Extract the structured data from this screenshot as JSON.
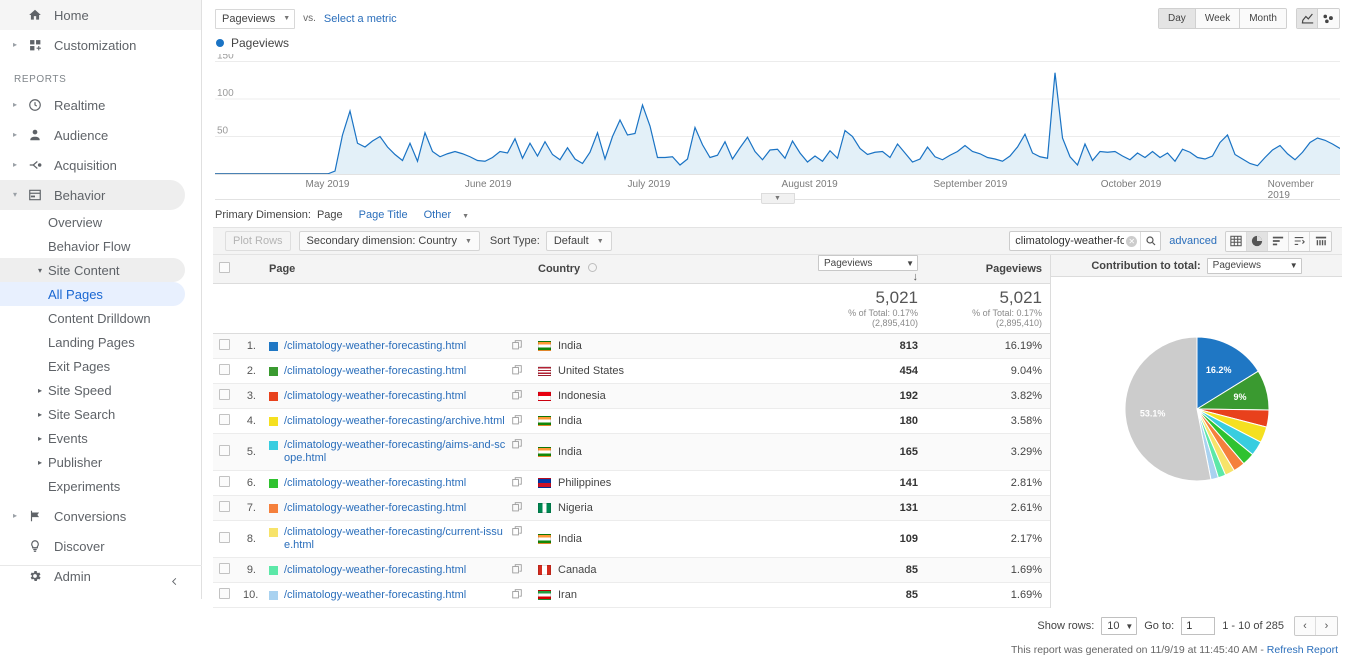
{
  "sidebar": {
    "top_items": [
      {
        "label": "Home",
        "icon": "home-icon",
        "expandable": false
      },
      {
        "label": "Customization",
        "icon": "customization-icon",
        "expandable": true
      }
    ],
    "section_label": "REPORTS",
    "report_items": [
      {
        "label": "Realtime",
        "icon": "realtime-clock-icon",
        "expandable": true
      },
      {
        "label": "Audience",
        "icon": "audience-person-icon",
        "expandable": true
      },
      {
        "label": "Acquisition",
        "icon": "acquisition-icon",
        "expandable": true
      },
      {
        "label": "Behavior",
        "icon": "behavior-icon",
        "expandable": true,
        "selected": true
      }
    ],
    "behavior_children": [
      {
        "label": "Overview"
      },
      {
        "label": "Behavior Flow"
      },
      {
        "label": "Site Content",
        "expanded": true
      },
      {
        "label": "All Pages",
        "active": true
      },
      {
        "label": "Content Drilldown"
      },
      {
        "label": "Landing Pages"
      },
      {
        "label": "Exit Pages"
      },
      {
        "label": "Site Speed",
        "collapsed": true
      },
      {
        "label": "Site Search",
        "collapsed": true
      },
      {
        "label": "Events",
        "collapsed": true
      },
      {
        "label": "Publisher",
        "collapsed": true
      },
      {
        "label": "Experiments"
      }
    ],
    "bottom_items": [
      {
        "label": "Conversions",
        "icon": "flag-icon",
        "expandable": true
      },
      {
        "label": "Discover",
        "icon": "bulb-icon",
        "expandable": false
      },
      {
        "label": "Admin",
        "icon": "gear-icon",
        "expandable": false
      }
    ],
    "collapse_icon": "chevron-left-icon"
  },
  "chart_controls": {
    "metric_selected": "Pageviews",
    "vs_label": "vs.",
    "select_metric_link": "Select a metric",
    "granularity": [
      "Day",
      "Week",
      "Month"
    ],
    "granularity_selected": "Day",
    "chart_type_icons": [
      "line-chart-icon",
      "scatter-chart-icon"
    ],
    "chart_type_selected": "line-chart-icon"
  },
  "legend": {
    "label": "Pageviews",
    "color": "#1a73c4"
  },
  "chart_data": {
    "type": "line",
    "title": "Pageviews",
    "xlabel": "",
    "ylabel": "",
    "ylim": [
      0,
      160
    ],
    "yticks": [
      50,
      100,
      150
    ],
    "grid": true,
    "series_color": "#1a73c4",
    "fill_color": "#e3f0f8",
    "x_tick_labels": [
      "May 2019",
      "June 2019",
      "July 2019",
      "August 2019",
      "September 2019",
      "October 2019",
      "November 2019"
    ],
    "series": [
      {
        "name": "Pageviews",
        "values": [
          0,
          0,
          0,
          0,
          0,
          0,
          0,
          0,
          0,
          0,
          0,
          0,
          0,
          0,
          0,
          0,
          4,
          52,
          84,
          41,
          36,
          44,
          50,
          36,
          26,
          18,
          41,
          17,
          55,
          30,
          23,
          27,
          30,
          27,
          23,
          18,
          17,
          22,
          30,
          28,
          47,
          21,
          41,
          24,
          43,
          26,
          19,
          35,
          20,
          14,
          29,
          55,
          20,
          50,
          72,
          52,
          54,
          92,
          64,
          22,
          22,
          23,
          12,
          20,
          62,
          39,
          22,
          25,
          43,
          20,
          35,
          49,
          30,
          19,
          32,
          33,
          21,
          44,
          28,
          16,
          24,
          17,
          31,
          21,
          58,
          50,
          34,
          26,
          29,
          30,
          22,
          40,
          28,
          16,
          20,
          36,
          23,
          19,
          25,
          30,
          38,
          30,
          27,
          22,
          20,
          17,
          24,
          36,
          53,
          28,
          23,
          21,
          135,
          48,
          23,
          12,
          40,
          18,
          30,
          29,
          30,
          24,
          19,
          28,
          22,
          30,
          22,
          28,
          17,
          33,
          29,
          22,
          20,
          24,
          42,
          52,
          26,
          20,
          14,
          11,
          22,
          32,
          38,
          27,
          19,
          29,
          42,
          48,
          45,
          40,
          34
        ]
      }
    ]
  },
  "primary_dimension": {
    "label": "Primary Dimension:",
    "current": "Page",
    "options": [
      "Page Title",
      "Other"
    ]
  },
  "toolbar": {
    "plot_rows": "Plot Rows",
    "secondary_dimension": "Secondary dimension: Country",
    "sort_type_label": "Sort Type:",
    "sort_type_value": "Default",
    "search_value": "climatology-weather-fo",
    "search_placeholder": "",
    "advanced": "advanced",
    "view_icons": [
      "table-view-icon",
      "pie-view-icon",
      "percent-bar-view-icon",
      "performance-view-icon",
      "pivot-view-icon"
    ],
    "view_selected": "pie-view-icon"
  },
  "table": {
    "headers": {
      "page": "Page",
      "country": "Country",
      "metric_select": "Pageviews",
      "pageviews": "Pageviews"
    },
    "totals": {
      "pageviews_value": "5,021",
      "pageviews_sub": "% of Total: 0.17% (2,895,410)",
      "percent_value": "5,021",
      "percent_sub": "% of Total: 0.17% (2,895,410)"
    },
    "rows": [
      {
        "index": "1.",
        "color": "#1f77c4",
        "page": "/climatology-weather-forecasting.html",
        "country": "India",
        "flag": "india",
        "pageviews": "813",
        "percent": "16.19%"
      },
      {
        "index": "2.",
        "color": "#3a9a30",
        "page": "/climatology-weather-forecasting.html",
        "country": "United States",
        "flag": "usa",
        "pageviews": "454",
        "percent": "9.04%"
      },
      {
        "index": "3.",
        "color": "#e8411c",
        "page": "/climatology-weather-forecasting.html",
        "country": "Indonesia",
        "flag": "indonesia",
        "pageviews": "192",
        "percent": "3.82%"
      },
      {
        "index": "4.",
        "color": "#f5e020",
        "page": "/climatology-weather-forecasting/archive.html",
        "country": "India",
        "flag": "india",
        "pageviews": "180",
        "percent": "3.58%"
      },
      {
        "index": "5.",
        "color": "#38cde0",
        "page": "/climatology-weather-forecasting/aims-and-scope.html",
        "country": "India",
        "flag": "india",
        "pageviews": "165",
        "percent": "3.29%"
      },
      {
        "index": "6.",
        "color": "#2fc22f",
        "page": "/climatology-weather-forecasting.html",
        "country": "Philippines",
        "flag": "philippines",
        "pageviews": "141",
        "percent": "2.81%"
      },
      {
        "index": "7.",
        "color": "#f5803c",
        "page": "/climatology-weather-forecasting.html",
        "country": "Nigeria",
        "flag": "nigeria",
        "pageviews": "131",
        "percent": "2.61%"
      },
      {
        "index": "8.",
        "color": "#f7e36a",
        "page": "/climatology-weather-forecasting/current-issue.html",
        "country": "India",
        "flag": "india",
        "pageviews": "109",
        "percent": "2.17%"
      },
      {
        "index": "9.",
        "color": "#5ce8a8",
        "page": "/climatology-weather-forecasting.html",
        "country": "Canada",
        "flag": "canada",
        "pageviews": "85",
        "percent": "1.69%"
      },
      {
        "index": "10.",
        "color": "#a9d2f0",
        "page": "/climatology-weather-forecasting.html",
        "country": "Iran",
        "flag": "iran",
        "pageviews": "85",
        "percent": "1.69%"
      }
    ]
  },
  "pie_panel": {
    "title": "Contribution to total:",
    "metric": "Pageviews",
    "chart_data": {
      "type": "pie",
      "title": "Contribution to total: Pageviews",
      "labels": [
        "16.2%",
        "9%",
        "",
        "",
        "",
        "",
        "",
        "",
        "",
        "",
        "53.1%"
      ],
      "slices": [
        {
          "label": "16.2%",
          "value": 16.19,
          "color": "#1f77c4",
          "show_label": true
        },
        {
          "label": "9%",
          "value": 9.04,
          "color": "#3a9a30",
          "show_label": true
        },
        {
          "label": "3.82%",
          "value": 3.82,
          "color": "#e8411c",
          "show_label": false
        },
        {
          "label": "3.58%",
          "value": 3.58,
          "color": "#f5e020",
          "show_label": false
        },
        {
          "label": "3.29%",
          "value": 3.29,
          "color": "#38cde0",
          "show_label": false
        },
        {
          "label": "2.81%",
          "value": 2.81,
          "color": "#2fc22f",
          "show_label": false
        },
        {
          "label": "2.61%",
          "value": 2.61,
          "color": "#f5803c",
          "show_label": false
        },
        {
          "label": "2.17%",
          "value": 2.17,
          "color": "#f7e36a",
          "show_label": false
        },
        {
          "label": "1.69%",
          "value": 1.69,
          "color": "#5ce8a8",
          "show_label": false
        },
        {
          "label": "1.69%",
          "value": 1.69,
          "color": "#a9d2f0",
          "show_label": false
        },
        {
          "label": "53.1%",
          "value": 53.1,
          "color": "#cccccc",
          "show_label": true
        }
      ]
    }
  },
  "footer": {
    "show_rows_label": "Show rows:",
    "show_rows_value": "10",
    "goto_label": "Go to:",
    "goto_value": "1",
    "range_text": "1 - 10 of 285",
    "prev_icon": "chevron-left-icon",
    "next_icon": "chevron-right-icon",
    "generated_text": "This report was generated on 11/9/19 at 11:45:40 AM - ",
    "refresh_link": "Refresh Report"
  }
}
